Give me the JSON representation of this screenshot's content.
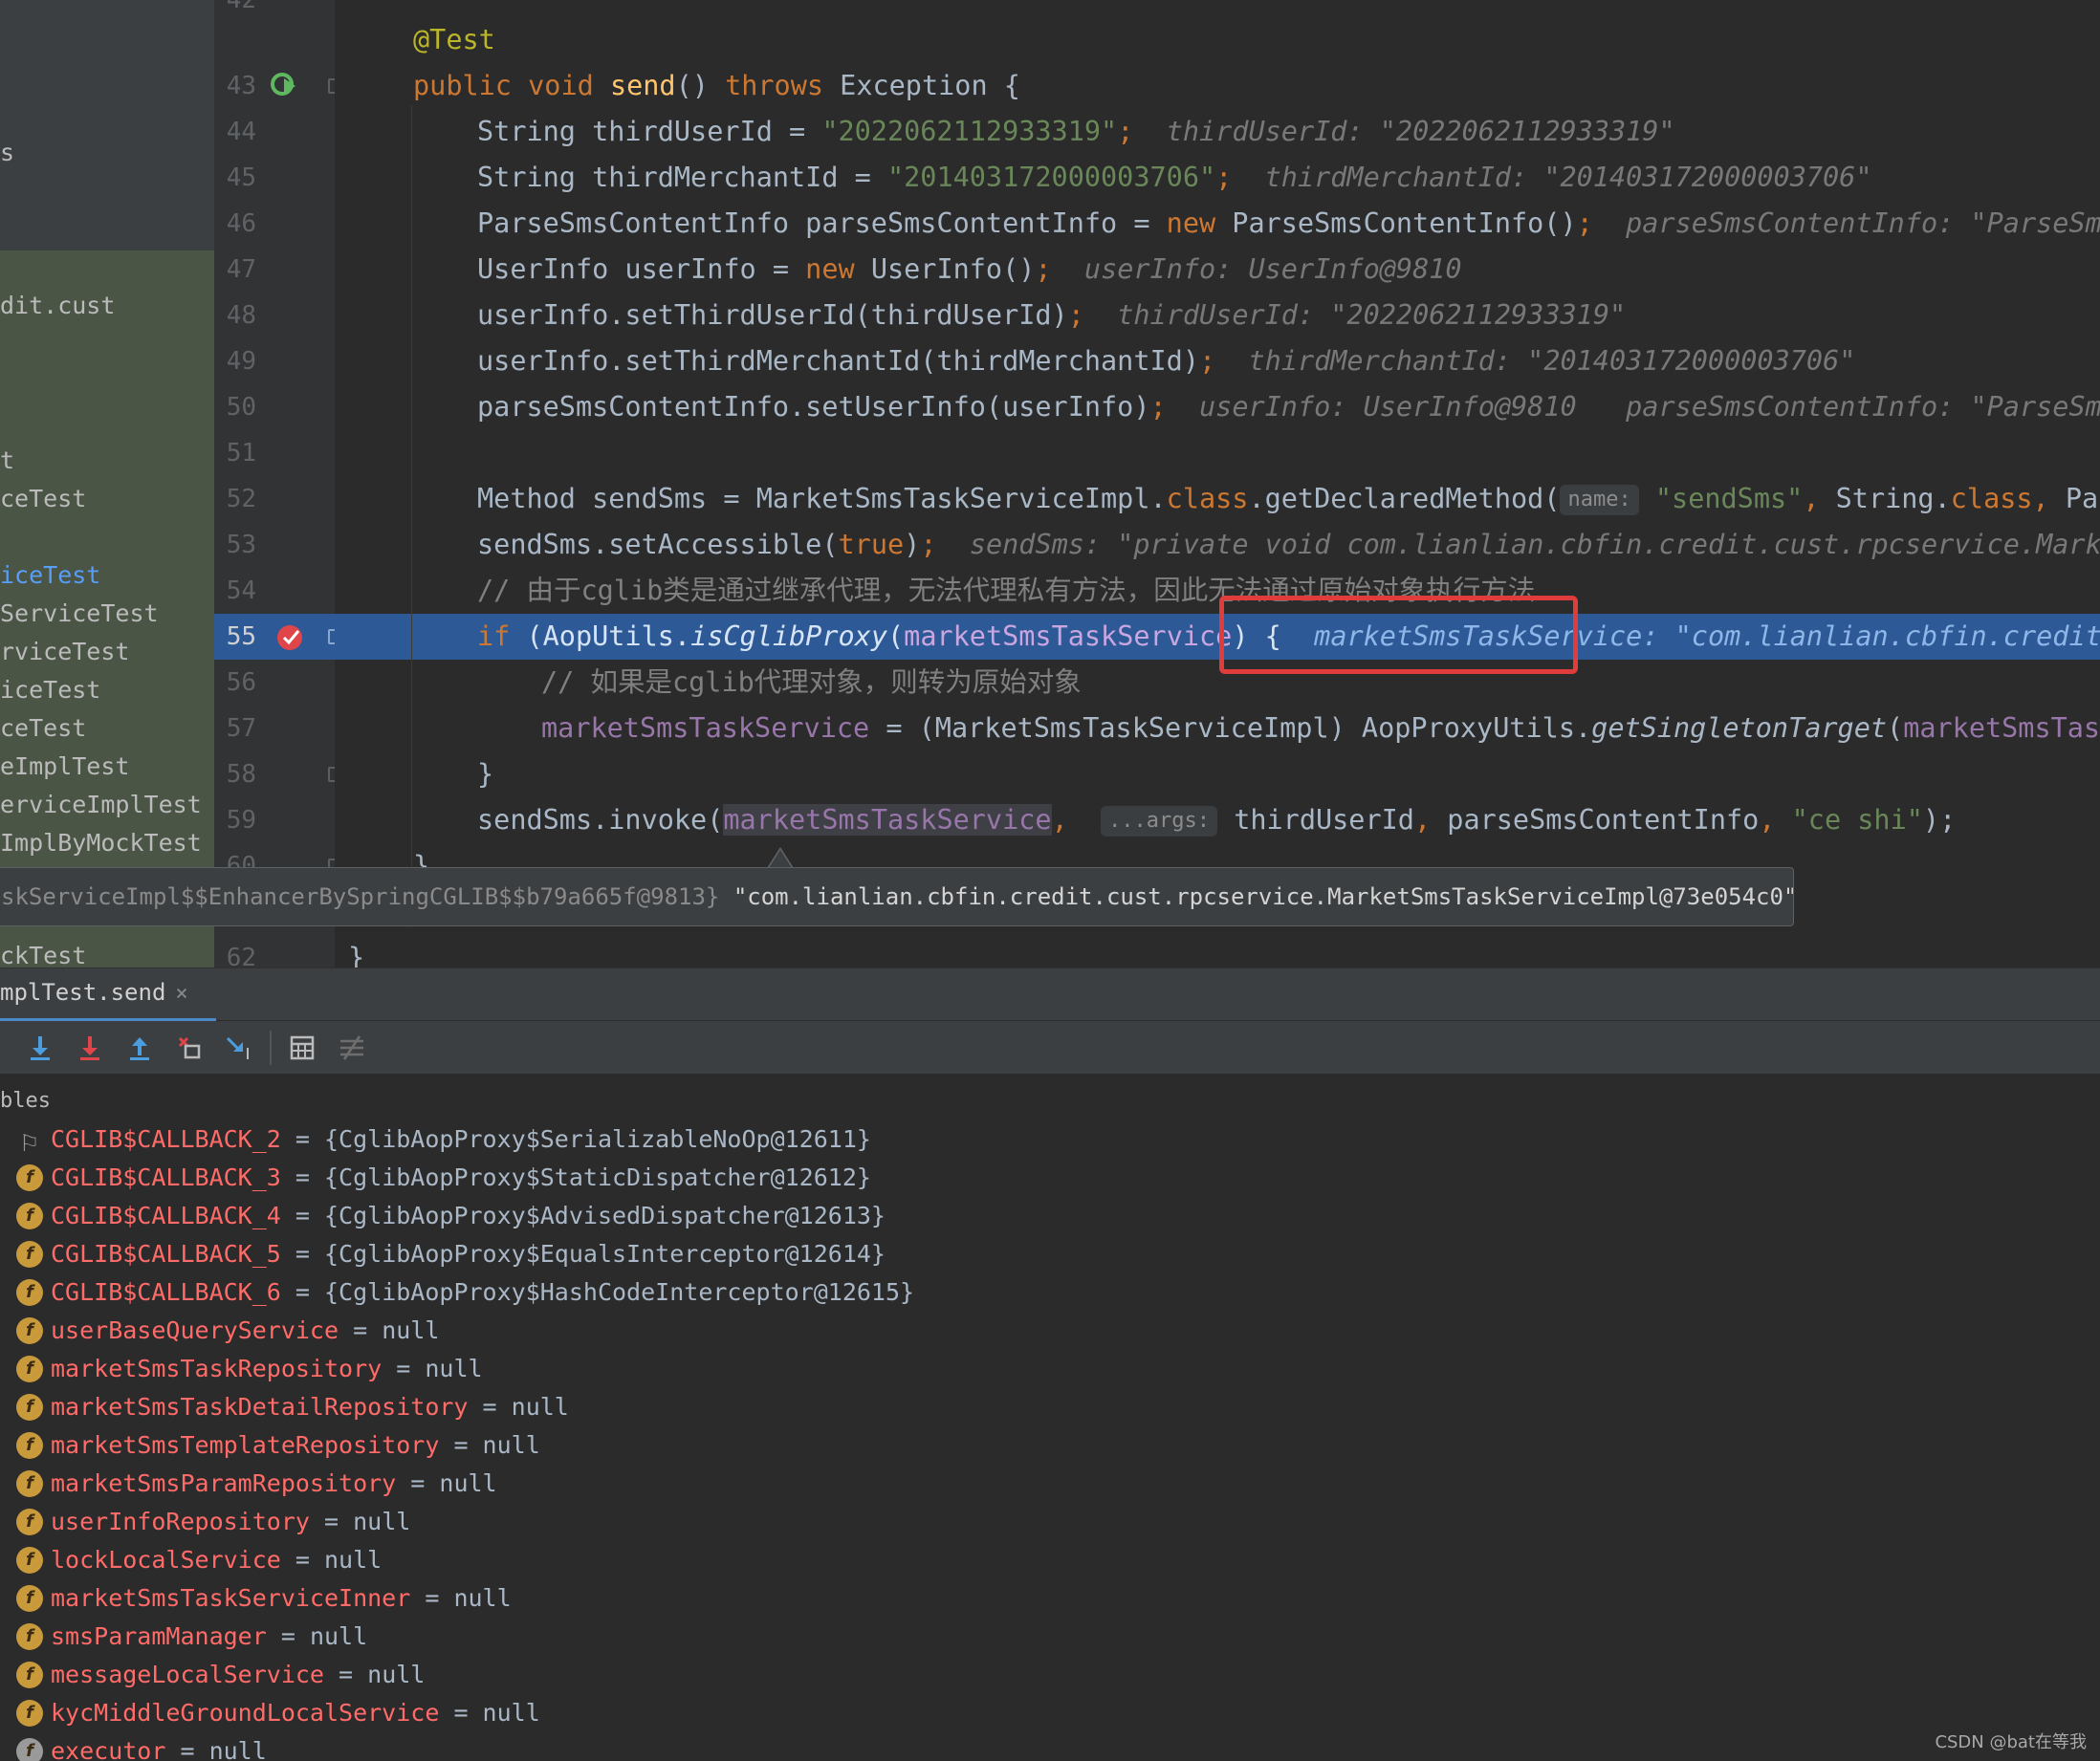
{
  "sidebar": {
    "items": [
      {
        "label": "s",
        "active": false
      },
      {
        "label": "dit.cust",
        "active": false
      },
      {
        "label": "t",
        "active": false
      },
      {
        "label": "ceTest",
        "active": false
      },
      {
        "label": "iceTest",
        "active": true
      },
      {
        "label": "ServiceTest",
        "active": false
      },
      {
        "label": "rviceTest",
        "active": false
      },
      {
        "label": "iceTest",
        "active": false
      },
      {
        "label": "ceTest",
        "active": false
      },
      {
        "label": "eImplTest",
        "active": false
      },
      {
        "label": "erviceImplTest",
        "active": false
      },
      {
        "label": "ImplByMockTest",
        "active": false
      },
      {
        "label": "ckTest",
        "active": false
      }
    ]
  },
  "gutter": {
    "line_numbers": [
      "42",
      "43",
      "44",
      "45",
      "46",
      "47",
      "48",
      "49",
      "50",
      "51",
      "52",
      "53",
      "54",
      "55",
      "56",
      "57",
      "58",
      "59",
      "60",
      "62"
    ],
    "current_line": "55"
  },
  "editor": {
    "l42": {
      "annotation": "@Test"
    },
    "l43": {
      "kw_public": "public",
      "kw_void": "void",
      "method": "send",
      "paren": "() ",
      "kw_throws": "throws",
      "rest": " Exception {"
    },
    "l44": {
      "code": "String thirdUserId = ",
      "str": "\"2022062112933319\"",
      "semi": ";",
      "hint": "thirdUserId: \"2022062112933319\""
    },
    "l45": {
      "code": "String thirdMerchantId = ",
      "str": "\"201403172000003706\"",
      "semi": ";",
      "hint": "thirdMerchantId: \"201403172000003706\""
    },
    "l46": {
      "code": "ParseSmsContentInfo parseSmsContentInfo = ",
      "kw": "new",
      "code2": " ParseSmsContentInfo()",
      "semi": ";",
      "hint": "parseSmsContentInfo: \"ParseSmsC"
    },
    "l47": {
      "code": "UserInfo userInfo = ",
      "kw": "new",
      "code2": " UserInfo()",
      "semi": ";",
      "hint": "userInfo: UserInfo@9810"
    },
    "l48": {
      "code": "userInfo.setThirdUserId(thirdUserId)",
      "semi": ";",
      "hint": "thirdUserId: \"2022062112933319\""
    },
    "l49": {
      "code": "userInfo.setThirdMerchantId(thirdMerchantId)",
      "semi": ";",
      "hint": "thirdMerchantId: \"201403172000003706\""
    },
    "l50": {
      "code": "parseSmsContentInfo.setUserInfo(userInfo)",
      "semi": ";",
      "hint": "userInfo: UserInfo@9810",
      "hint2": "parseSmsContentInfo: \"ParseSms"
    },
    "l52": {
      "code": "Method sendSms = MarketSmsTaskServiceImpl.",
      "kw": "class",
      "code2": ".getDeclaredMethod(",
      "param": "name:",
      "str": "\"sendSms\"",
      "comma": ", ",
      "code3": "String.",
      "kw2": "class",
      "comma2": ", ",
      "code4": "Pars"
    },
    "l53": {
      "code": "sendSms.setAccessible(",
      "kw": "true",
      "code2": ")",
      "semi": ";",
      "hint": "sendSms: \"private void com.lianlian.cbfin.credit.cust.rpcservice.Market"
    },
    "l54": {
      "comment": "// 由于cglib类是通过继承代理，无法代理私有方法，因此无法通过原始对象执行方法"
    },
    "l55": {
      "kw": "if",
      "code": " (AopUtils.",
      "call": "isCglibProxy",
      "paren": "(",
      "field": "marketSmsTaskService",
      "code2": ")",
      "brace": " {",
      "hint": "marketSmsTaskService: \"com.lianlian.cbfin.credit."
    },
    "l56": {
      "comment": "// 如果是cglib代理对象，则转为原始对象"
    },
    "l57": {
      "field": "marketSmsTaskService",
      "code": " = (MarketSmsTaskServiceImpl) AopProxyUtils.",
      "call": "getSingletonTarget",
      "paren": "(",
      "field2": "marketSmsTaskS"
    },
    "l58": {
      "brace": "}"
    },
    "l59": {
      "code": "sendSms.invoke(",
      "field": "marketSmsTaskService",
      "comma": ",",
      "param": "...args:",
      "code2": "thirdUserId",
      "comma2": ",",
      "code3": " parseSmsContentInfo",
      "comma3": ",",
      "str": " \"ce shi\"",
      "code4": ");"
    },
    "l60": {
      "brace": "}"
    },
    "l62": {
      "brace": "}"
    }
  },
  "tooltip": {
    "type_text": "skServiceImpl$$EnhancerBySpringCGLIB$$b79a665f@9813}",
    "value_text": "\"com.lianlian.cbfin.credit.cust.rpcservice.MarketSmsTaskServiceImpl@73e054c0\""
  },
  "debug": {
    "tab_label": "mplTest.send",
    "tab_close": "×",
    "toolbar": [
      "step-over-icon",
      "step-into-icon",
      "force-step-into-icon",
      "step-out-icon",
      "drop-frame-icon",
      "run-to-cursor-icon",
      "evaluate-expression-icon",
      "trace-icon"
    ],
    "vars_header": "bles",
    "variables": [
      {
        "icon": "flag",
        "name": "CGLIB$CALLBACK_2",
        "eq": " = ",
        "value": "{CglibAopProxy$SerializableNoOp@12611}",
        "expandable": true
      },
      {
        "icon": "f",
        "name": "CGLIB$CALLBACK_3",
        "eq": " = ",
        "value": "{CglibAopProxy$StaticDispatcher@12612}",
        "expandable": true
      },
      {
        "icon": "f",
        "name": "CGLIB$CALLBACK_4",
        "eq": " = ",
        "value": "{CglibAopProxy$AdvisedDispatcher@12613}",
        "expandable": true
      },
      {
        "icon": "f",
        "name": "CGLIB$CALLBACK_5",
        "eq": " = ",
        "value": "{CglibAopProxy$EqualsInterceptor@12614}",
        "expandable": true
      },
      {
        "icon": "f",
        "name": "CGLIB$CALLBACK_6",
        "eq": " = ",
        "value": "{CglibAopProxy$HashCodeInterceptor@12615}",
        "expandable": true
      },
      {
        "icon": "f",
        "name": "userBaseQueryService",
        "eq": " = ",
        "value": "null",
        "expandable": false
      },
      {
        "icon": "f",
        "name": "marketSmsTaskRepository",
        "eq": " = ",
        "value": "null",
        "expandable": false
      },
      {
        "icon": "f",
        "name": "marketSmsTaskDetailRepository",
        "eq": " = ",
        "value": "null",
        "expandable": false
      },
      {
        "icon": "f",
        "name": "marketSmsTemplateRepository",
        "eq": " = ",
        "value": "null",
        "expandable": false
      },
      {
        "icon": "f",
        "name": "marketSmsParamRepository",
        "eq": " = ",
        "value": "null",
        "expandable": false
      },
      {
        "icon": "f",
        "name": "userInfoRepository",
        "eq": " = ",
        "value": "null",
        "expandable": false
      },
      {
        "icon": "f",
        "name": "lockLocalService",
        "eq": " = ",
        "value": "null",
        "expandable": false
      },
      {
        "icon": "f",
        "name": "marketSmsTaskServiceInner",
        "eq": " = ",
        "value": "null",
        "expandable": false
      },
      {
        "icon": "f",
        "name": "smsParamManager",
        "eq": " = ",
        "value": "null",
        "expandable": false
      },
      {
        "icon": "f",
        "name": "messageLocalService",
        "eq": " = ",
        "value": "null",
        "expandable": false
      },
      {
        "icon": "f",
        "name": "kycMiddleGroundLocalService",
        "eq": " = ",
        "value": "null",
        "expandable": false
      },
      {
        "icon": "f",
        "name": "executor",
        "eq": " = ",
        "value": "null",
        "expandable": false
      }
    ]
  },
  "watermark": "CSDN @bat在等我",
  "colors": {
    "background": "#2b2b2b",
    "keyword": "#cc7832",
    "string": "#6a8759",
    "field": "#9876aa",
    "method_decl": "#ffc66d",
    "annotation": "#bbb529",
    "exec_line": "#2d5a96",
    "highlight_box": "#e03c3c",
    "var_name": "#ff6b68"
  }
}
